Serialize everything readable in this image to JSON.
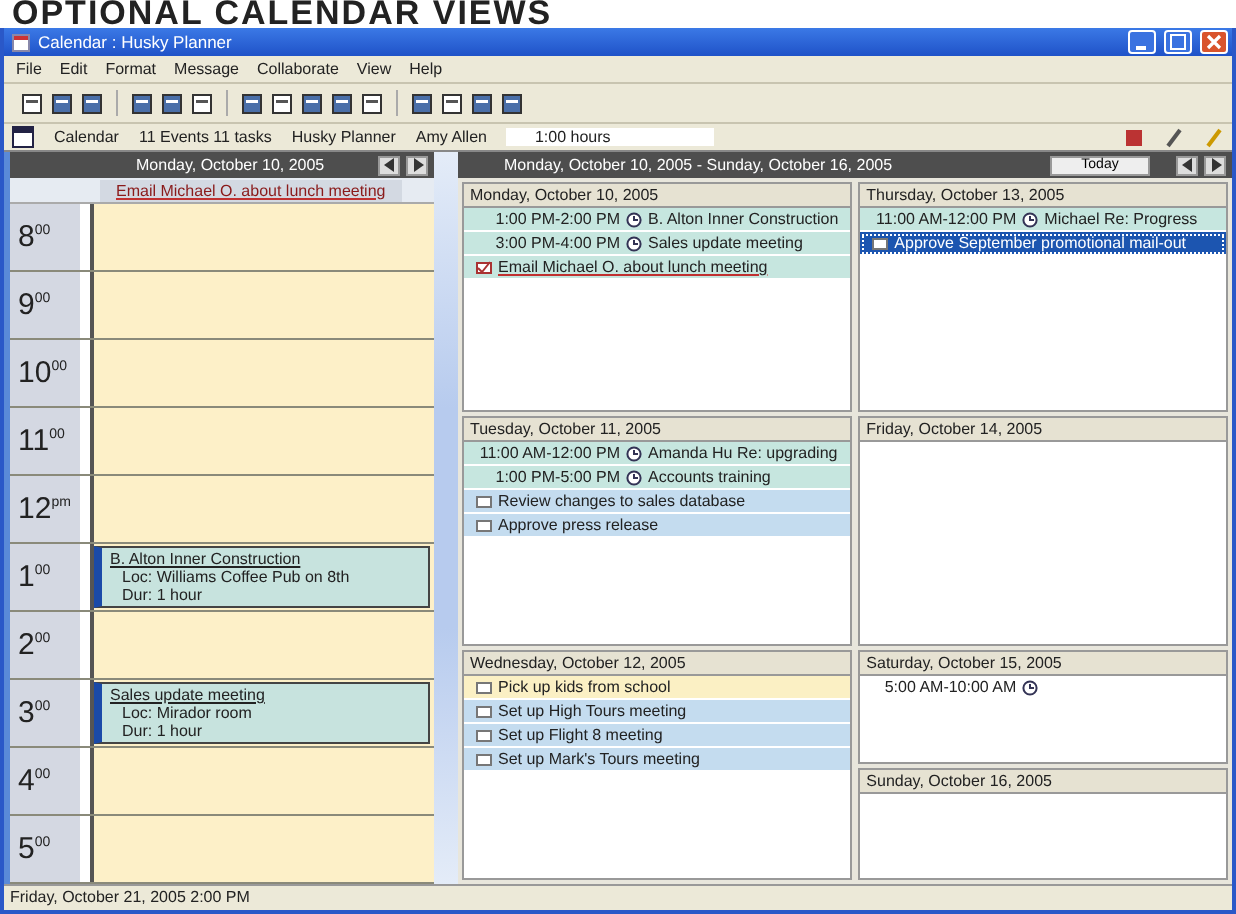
{
  "heading": "OPTIONAL CALENDAR VIEWS",
  "window": {
    "title": "Calendar : Husky Planner"
  },
  "menu": [
    "File",
    "Edit",
    "Format",
    "Message",
    "Collaborate",
    "View",
    "Help"
  ],
  "info_bar": {
    "items": [
      "Calendar",
      "11 Events 11 tasks",
      "Husky Planner",
      "Amy Allen"
    ],
    "field": "1:00 hours"
  },
  "day_view": {
    "header": "Monday, October 10, 2005",
    "banner_task": {
      "text": "Email Michael O. about lunch meeting",
      "done": true
    },
    "hours": [
      {
        "label": "8$^{00}$"
      },
      {
        "label": "9$^{00}$"
      },
      {
        "label": "10$^{00}$"
      },
      {
        "label": "11$^{00}$"
      },
      {
        "label": "12$^{pm}$"
      },
      {
        "label": "1$^{00}$",
        "event": {
          "title": "B. Alton Inner Construction",
          "location": "Loc: Williams Coffee Pub on 8th",
          "duration": "Dur: 1 hour"
        }
      },
      {
        "label": "2$^{00}$"
      },
      {
        "label": "3$^{00}$",
        "event": {
          "title": "Sales update meeting",
          "location": "Loc: Mirador room",
          "duration": "Dur: 1 hour"
        }
      },
      {
        "label": "4$^{00}$"
      },
      {
        "label": "5$^{00}$"
      }
    ]
  },
  "week_view": {
    "header": "Monday, October 10, 2005 - Sunday, October 16, 2005",
    "today_button": "Today",
    "days": [
      {
        "name": "Monday, October 10, 2005",
        "entries": [
          {
            "kind": "appointment",
            "time": "1:00 PM-2:00 PM",
            "text": "B. Alton Inner Construction",
            "color": "#c6e6df",
            "selected": false
          },
          {
            "kind": "appointment",
            "time": "3:00 PM-4:00 PM",
            "text": "Sales update meeting",
            "color": "#c6e6df",
            "selected": false
          },
          {
            "kind": "task",
            "text": "Email Michael O. about lunch meeting",
            "color": "#c6e6df",
            "done": true,
            "selected": false
          }
        ]
      },
      {
        "name": "Tuesday, October 11, 2005",
        "entries": [
          {
            "kind": "appointment",
            "time": "11:00 AM-12:00 PM",
            "text": "Amanda Hu Re: upgrading",
            "color": "#c6e6df",
            "selected": false
          },
          {
            "kind": "appointment",
            "time": "1:00 PM-5:00 PM",
            "text": "Accounts training",
            "color": "#c6e6df",
            "selected": false
          },
          {
            "kind": "task",
            "text": "Review changes to sales database",
            "color": "#c4dcef",
            "done": false,
            "selected": false
          },
          {
            "kind": "task",
            "text": "Approve press release",
            "color": "#c4dcef",
            "done": false,
            "selected": false
          }
        ]
      },
      {
        "name": "Wednesday, October 12, 2005",
        "entries": [
          {
            "kind": "task",
            "text": "Pick up kids from school",
            "color": "#fbf0c4",
            "done": false,
            "selected": false
          },
          {
            "kind": "task",
            "text": "Set up High Tours meeting",
            "color": "#c4dcef",
            "done": false,
            "selected": false
          },
          {
            "kind": "task",
            "text": "Set up Flight 8 meeting",
            "color": "#c4dcef",
            "done": false,
            "selected": false
          },
          {
            "kind": "task",
            "text": "Set up Mark's Tours meeting",
            "color": "#c4dcef",
            "done": false,
            "selected": false
          }
        ]
      },
      {
        "name": "Thursday, October 13, 2005",
        "entries": [
          {
            "kind": "appointment",
            "time": "11:00 AM-12:00 PM",
            "text": "Michael Re: Progress",
            "color": "#c6e6df",
            "selected": false
          },
          {
            "kind": "task",
            "text": "Approve September promotional mail-out",
            "color": "#1c55b0",
            "done": false,
            "selected": true
          }
        ]
      },
      {
        "name": "Friday, October 14, 2005"
      },
      {
        "name": "Saturday, October 15, 2005",
        "entries": [
          {
            "kind": "appointment",
            "time": "5:00 AM-10:00 AM",
            "color": "#ffffff",
            "selected": false
          }
        ]
      },
      {
        "name": "Sunday, October 16, 2005"
      }
    ]
  },
  "status_bar": "Friday, October 21, 2005 2:00 PM"
}
